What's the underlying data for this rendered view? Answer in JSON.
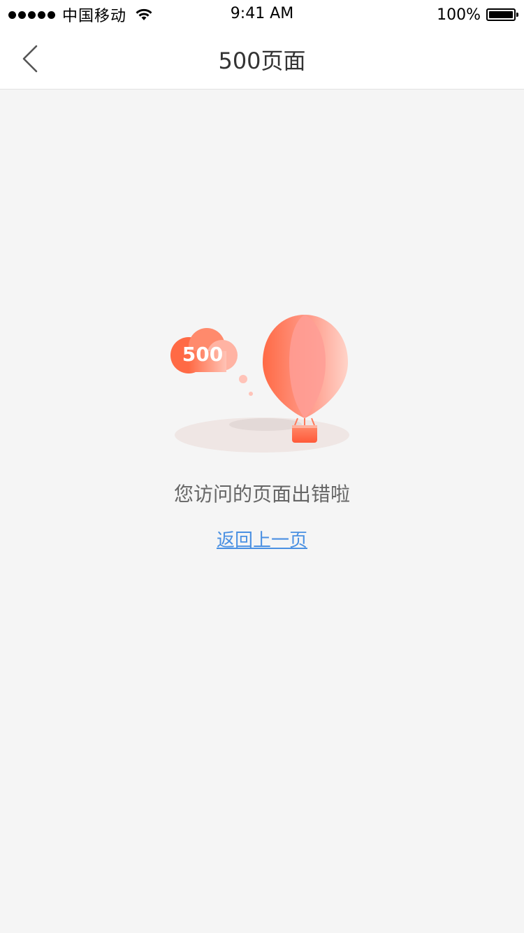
{
  "status_bar": {
    "carrier": "中国移动",
    "time": "9:41 AM",
    "battery": "100%"
  },
  "nav": {
    "title": "500页面",
    "back_icon": "chevron-left-icon"
  },
  "illustration": {
    "code": "500",
    "accent_color": "#ff6a45",
    "balloon_light_color": "#ffb3a6"
  },
  "content": {
    "message": "您访问的页面出错啦",
    "link_label": "返回上一页",
    "link_color": "#4a90e2"
  }
}
